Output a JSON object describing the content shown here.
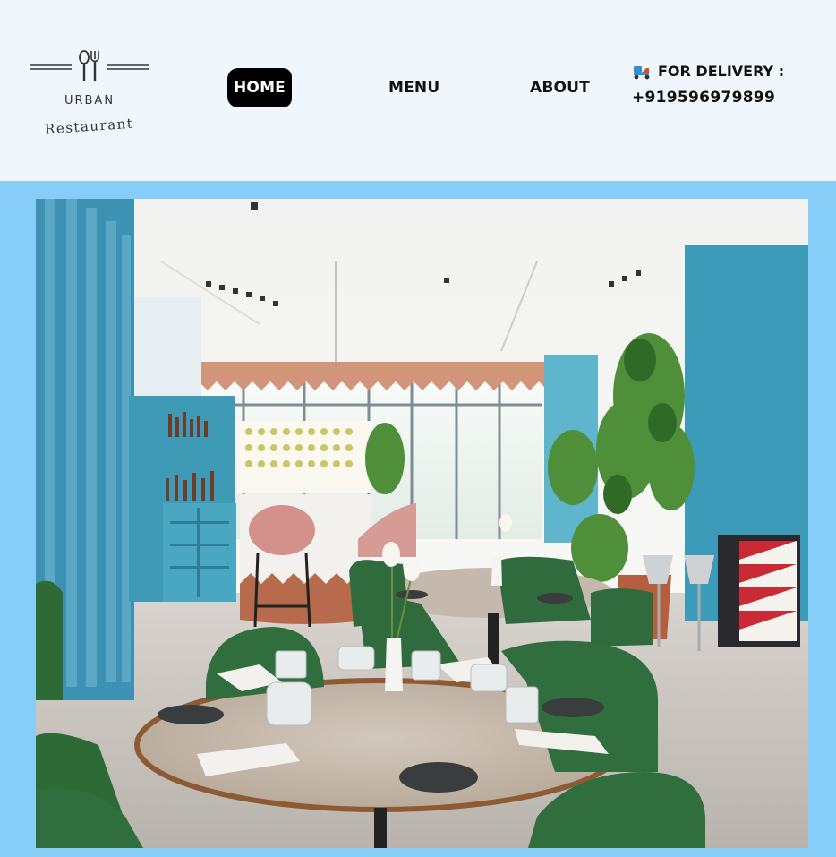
{
  "logo": {
    "brand_top": "URBAN",
    "brand_bottom": "Restaurant"
  },
  "nav": {
    "home": "HOME",
    "menu": "MENU",
    "about": "ABOUT"
  },
  "delivery": {
    "label": "FOR DELIVERY :",
    "phone": "+919596979899",
    "icon": "delivery-scooter-icon"
  },
  "colors": {
    "header_bg": "#eff7fd",
    "hero_band": "#86cdf8",
    "active_nav_bg": "#000000"
  },
  "hero": {
    "image": "restaurant-interior-photo"
  }
}
